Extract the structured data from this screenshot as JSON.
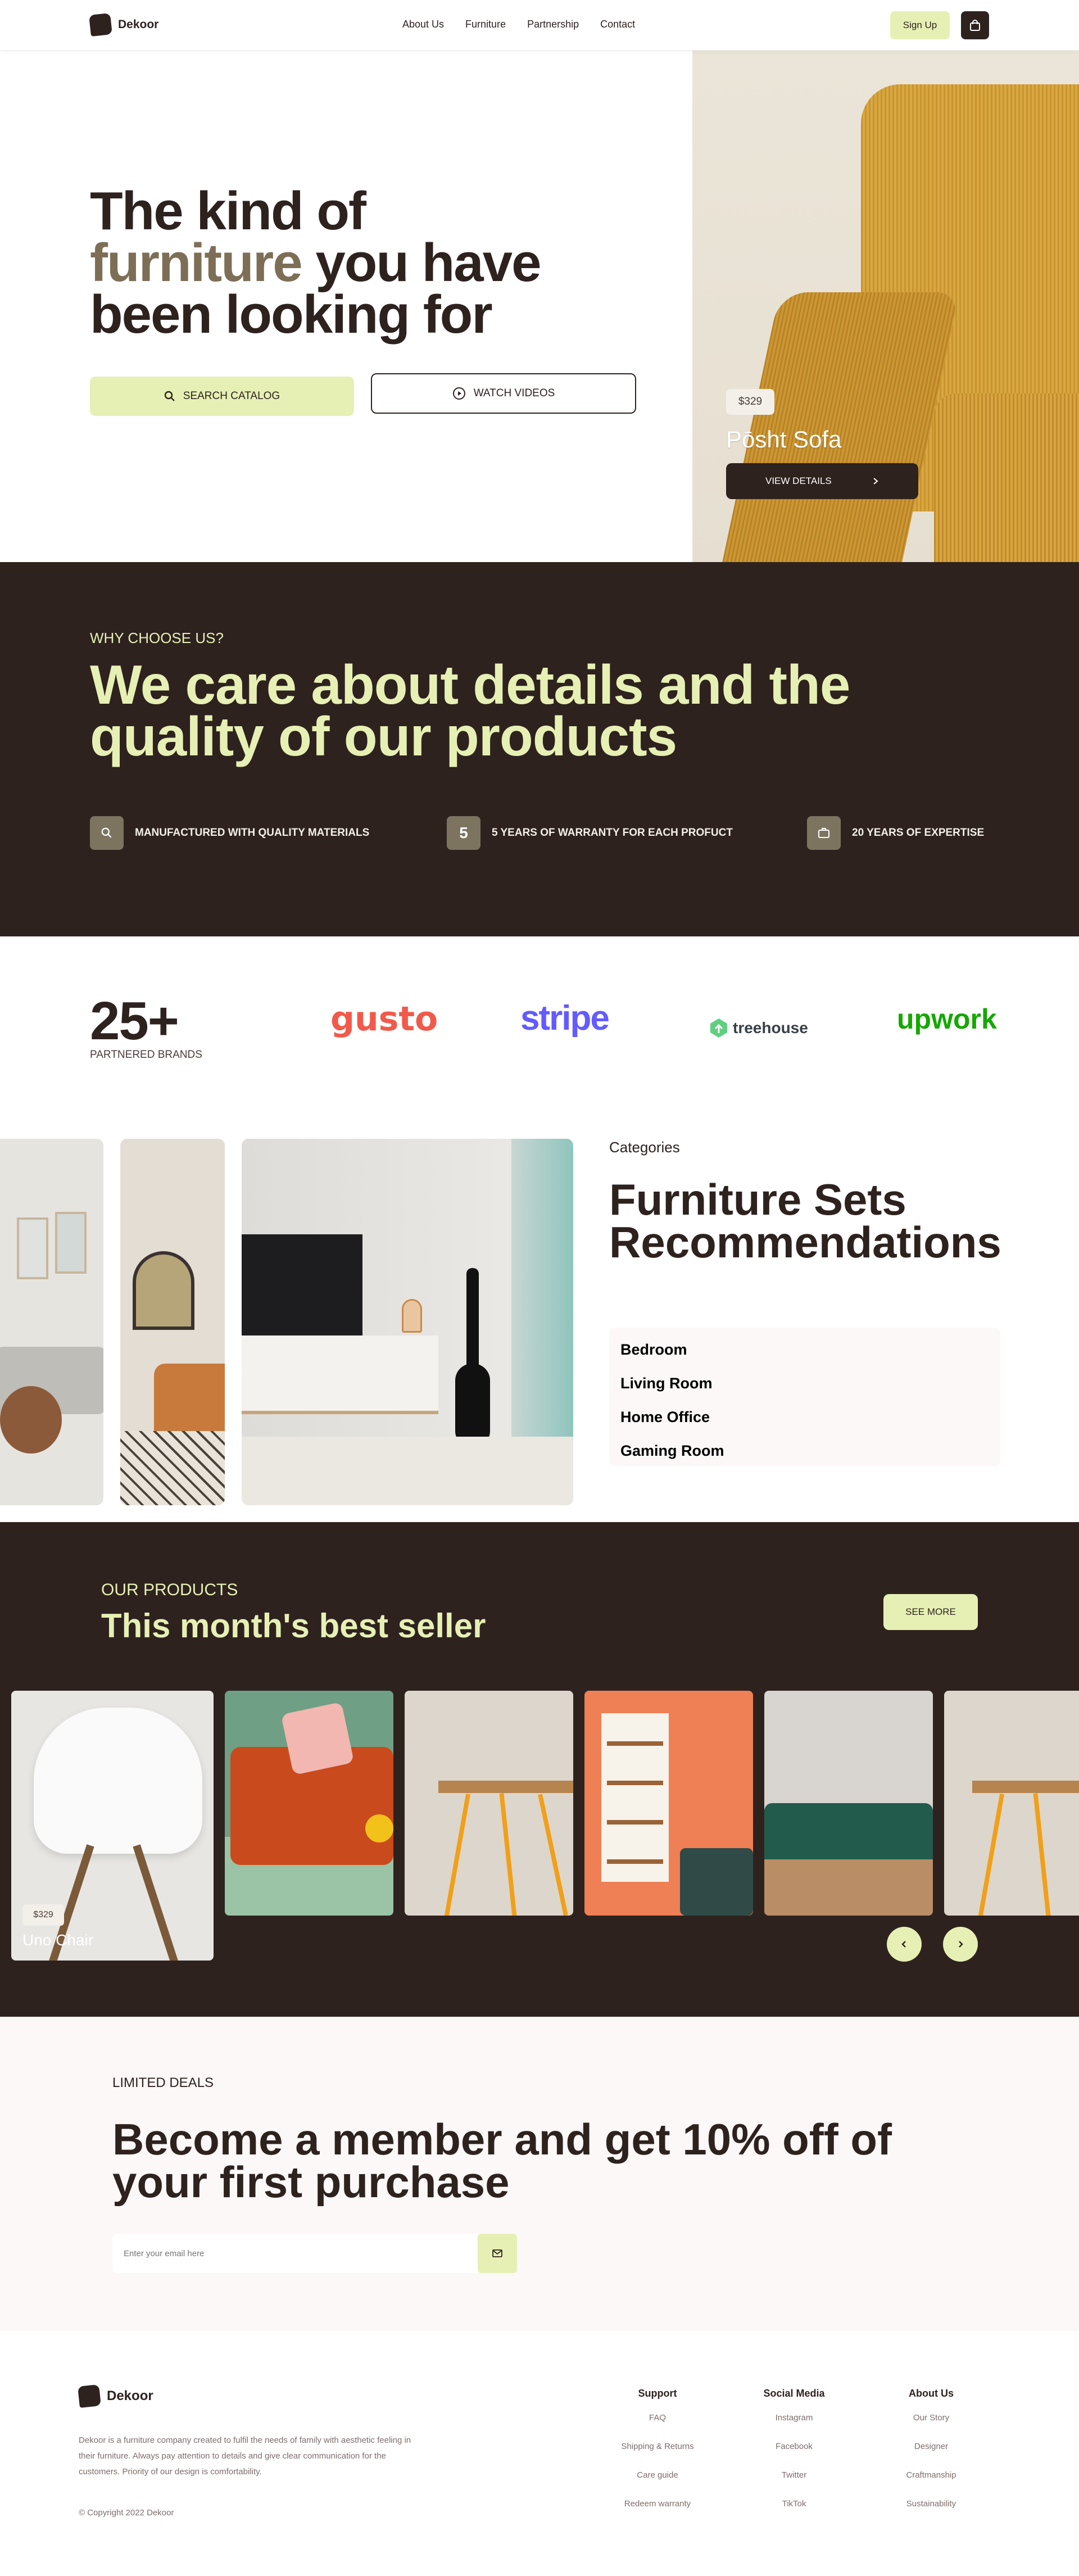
{
  "header": {
    "brand": "Dekoor",
    "nav": [
      "About Us",
      "Furniture",
      "Partnership",
      "Contact"
    ],
    "signup_label": "Sign Up",
    "cart_icon": "shopping-bag-icon"
  },
  "hero": {
    "title_line1": "The kind of",
    "title_accent": "furniture",
    "title_line2_rest": " you have",
    "title_line3": "been looking for",
    "search_label": "SEARCH CATALOG",
    "watch_label": "WATCH VIDEOS",
    "featured": {
      "price": "$329",
      "name": "Pōsht Sofa",
      "view_label": "VIEW DETAILS"
    }
  },
  "why": {
    "eyebrow": "WHY CHOOSE US?",
    "title": "We care about details and the quality of our products",
    "features": [
      {
        "icon": "search-icon",
        "glyph": "",
        "label": "MANUFACTURED WITH QUALITY MATERIALS"
      },
      {
        "icon": "number-five-icon",
        "glyph": "5",
        "label": "5 YEARS OF WARRANTY FOR EACH PROFUCT"
      },
      {
        "icon": "briefcase-icon",
        "glyph": "",
        "label": "20 YEARS OF EXPERTISE"
      }
    ]
  },
  "partners": {
    "count": "25+",
    "label": "PARTNERED BRANDS",
    "brands": [
      "gusto",
      "stripe",
      "treehouse",
      "upwork"
    ]
  },
  "categories": {
    "eyebrow": "Categories",
    "title_line1": "Furniture Sets",
    "title_line2": "Recommendations",
    "items": [
      "Bedroom",
      "Living Room",
      "Home Office",
      "Gaming Room"
    ]
  },
  "best_seller": {
    "eyebrow": "OUR PRODUCTS",
    "title": "This month's best seller",
    "see_more_label": "SEE MORE",
    "featured_card": {
      "price": "$329",
      "name": "Uno Chair"
    },
    "prev_icon": "chevron-left-icon",
    "next_icon": "chevron-right-icon"
  },
  "deals": {
    "eyebrow": "LIMITED DEALS",
    "title_line1": "Become a member and get 10% off of",
    "title_line2": "your first purchase",
    "email_placeholder": "Enter your email here",
    "submit_icon": "mail-icon"
  },
  "footer": {
    "brand": "Dekoor",
    "description": "Dekoor is a furniture company created to fulfil the needs of family with aesthetic feeling in their furniture. Always pay attention to details and give clear communication for the customers. Priority of our design is comfortability.",
    "copyright": "© Copyright 2022 Dekoor",
    "columns": [
      {
        "title": "Support",
        "links": [
          "FAQ",
          "Shipping & Returns",
          "Care guide",
          "Redeem warranty"
        ]
      },
      {
        "title": "Social Media",
        "links": [
          "Instagram",
          "Facebook",
          "Twitter",
          "TikTok"
        ]
      },
      {
        "title": "About Us",
        "links": [
          "Our Story",
          "Designer",
          "Craftmanship",
          "Sustainability"
        ]
      }
    ]
  },
  "colors": {
    "dark": "#2e221f",
    "accent_lime": "#e6f0b4",
    "olive": "#7d6e56"
  }
}
